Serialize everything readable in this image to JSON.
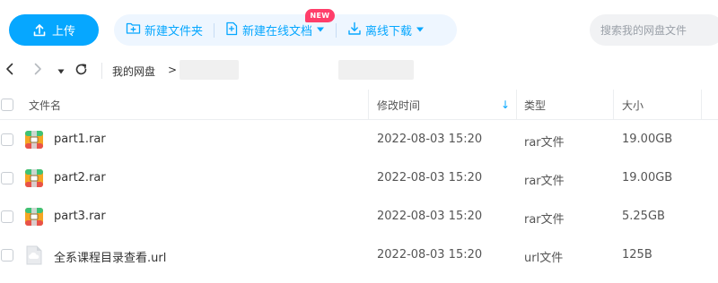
{
  "toolbar": {
    "upload_label": "上传",
    "new_folder_label": "新建文件夹",
    "new_online_doc_label": "新建在线文档",
    "new_badge": "NEW",
    "offline_download_label": "离线下载",
    "search_placeholder": "搜索我的网盘文件"
  },
  "breadcrumb": {
    "root": "我的网盘",
    "separator": ">"
  },
  "table": {
    "columns": {
      "name": "文件名",
      "modified": "修改时间",
      "type": "类型",
      "size": "大小"
    },
    "sort_indicator": "↓",
    "rows": [
      {
        "name": "part1.rar",
        "modified": "2022-08-03 15:20",
        "type": "rar文件",
        "size": "19.00GB",
        "icon": "rar-archive-icon"
      },
      {
        "name": "part2.rar",
        "modified": "2022-08-03 15:20",
        "type": "rar文件",
        "size": "19.00GB",
        "icon": "rar-archive-icon"
      },
      {
        "name": "part3.rar",
        "modified": "2022-08-03 15:20",
        "type": "rar文件",
        "size": "5.25GB",
        "icon": "rar-archive-icon"
      },
      {
        "name": "全系课程目录查看.url",
        "modified": "2022-08-03 15:20",
        "type": "url文件",
        "size": "125B",
        "icon": "url-file-icon"
      }
    ]
  },
  "colors": {
    "accent": "#06a7ff",
    "badge": "#ff3e6a",
    "pill_bg": "#eef6ff"
  }
}
